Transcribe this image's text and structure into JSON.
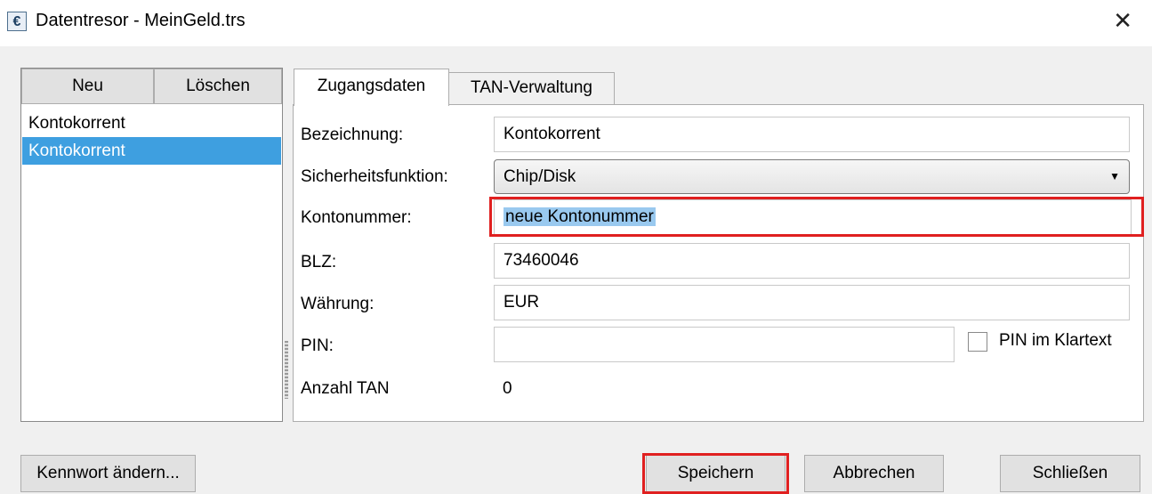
{
  "window": {
    "title": "Datentresor - MeinGeld.trs",
    "icon": "euro-icon",
    "icon_glyph": "€",
    "close_glyph": "✕"
  },
  "list": {
    "new_label": "Neu",
    "delete_label": "Löschen",
    "items": [
      {
        "label": "Kontokorrent",
        "selected": false
      },
      {
        "label": "Kontokorrent",
        "selected": true
      }
    ]
  },
  "tabs": [
    {
      "label": "Zugangsdaten",
      "active": true
    },
    {
      "label": "TAN-Verwaltung",
      "active": false
    }
  ],
  "form": {
    "bezeichnung": {
      "label": "Bezeichnung:",
      "value": "Kontokorrent"
    },
    "sicherheitsfunktion": {
      "label": "Sicherheitsfunktion:",
      "value": "Chip/Disk"
    },
    "kontonummer": {
      "label": "Kontonummer:",
      "value": "neue Kontonummer"
    },
    "blz": {
      "label": "BLZ:",
      "value": "73460046"
    },
    "waehrung": {
      "label": "Währung:",
      "value": "EUR"
    },
    "pin": {
      "label": "PIN:",
      "value": ""
    },
    "pin_klartext": {
      "label": "PIN im Klartext",
      "checked": false
    },
    "anzahl_tan": {
      "label": "Anzahl TAN",
      "value": "0"
    }
  },
  "buttons": {
    "change_password": "Kennwort ändern...",
    "save": "Speichern",
    "cancel": "Abbrechen",
    "close": "Schließen"
  },
  "colors": {
    "selection": "#3e9fe0",
    "highlight": "#e02020",
    "text_selection": "#99c9ef"
  }
}
